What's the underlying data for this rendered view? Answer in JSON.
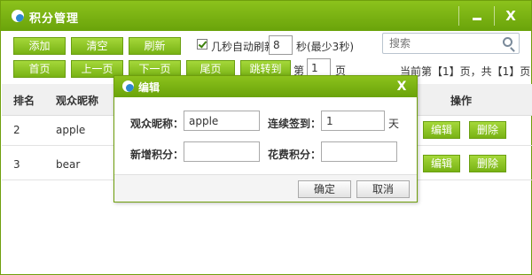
{
  "window": {
    "title": "积分管理",
    "minimize_label": "–",
    "close_label": "X"
  },
  "toolbar": {
    "add": "添加",
    "clear": "清空",
    "refresh": "刷新",
    "auto_refresh_checked": true,
    "auto_refresh_label": "几秒自动刷新",
    "auto_refresh_value": "8",
    "auto_refresh_suffix": "秒(最少3秒)",
    "search_placeholder": "搜索"
  },
  "pager": {
    "first": "首页",
    "prev": "上一页",
    "next": "下一页",
    "last": "尾页",
    "goto": "跳转到",
    "page_prefix": "第",
    "page_value": "1",
    "page_suffix": "页",
    "status": "当前第【1】页，共【1】页"
  },
  "table": {
    "headers": {
      "rank": "排名",
      "nickname": "观众昵称",
      "actions": "操作"
    },
    "rows": [
      {
        "rank": "2",
        "nickname": "apple",
        "edit": "编辑",
        "delete": "删除"
      },
      {
        "rank": "3",
        "nickname": "bear",
        "edit": "编辑",
        "delete": "删除"
      }
    ]
  },
  "dialog": {
    "title": "编辑",
    "close_label": "X",
    "nickname_label": "观众昵称：",
    "nickname_value": "apple",
    "streak_label": "连续签到：",
    "streak_value": "1",
    "streak_unit": "天",
    "add_points_label": "新增积分：",
    "add_points_value": "",
    "spend_points_label": "花费积分：",
    "spend_points_value": "",
    "confirm": "确定",
    "cancel": "取消"
  },
  "colors": {
    "accent": "#78b214",
    "accent_dark": "#6a9f10",
    "header_bg": "#f0f0f0"
  }
}
